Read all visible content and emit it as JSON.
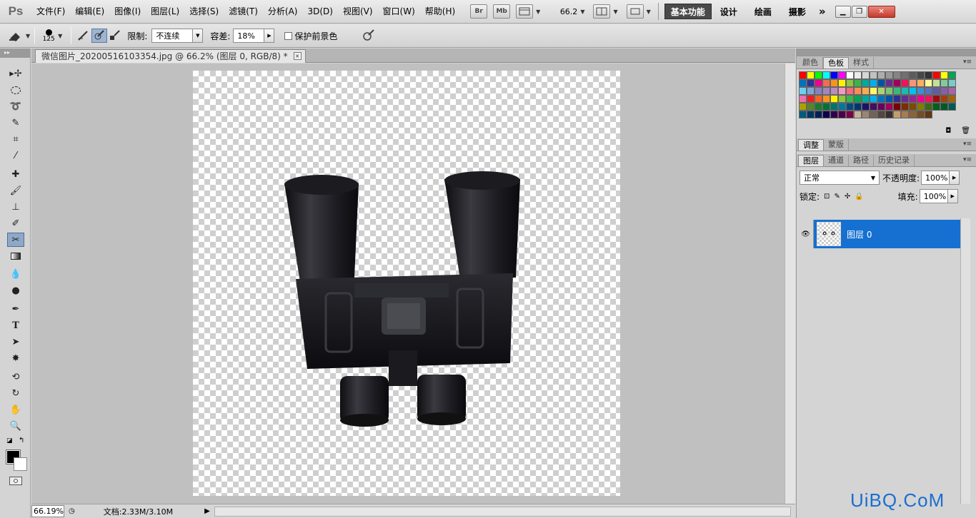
{
  "menubar": {
    "logo": "Ps",
    "items": [
      "文件(F)",
      "编辑(E)",
      "图像(I)",
      "图层(L)",
      "选择(S)",
      "滤镜(T)",
      "分析(A)",
      "3D(D)",
      "视图(V)",
      "窗口(W)",
      "帮助(H)"
    ],
    "bridge_label": "Br",
    "minibridge_label": "Mb",
    "zoom": "66.2",
    "workspaces": [
      "基本功能",
      "设计",
      "绘画",
      "摄影"
    ],
    "more": "»"
  },
  "options": {
    "brush_size": "125",
    "limit_label": "限制:",
    "limit_value": "不连续",
    "tolerance_label": "容差:",
    "tolerance_value": "18%",
    "protect_label": "保护前景色"
  },
  "document": {
    "tab_title": "微信图片_20200516103354.jpg @ 66.2% (图层 0, RGB/8) *",
    "close": "×"
  },
  "statusbar": {
    "zoom": "66.19%",
    "doc_info": "文档:2.33M/3.10M"
  },
  "swatches_panel": {
    "tabs": [
      "颜色",
      "色板",
      "样式"
    ],
    "active_tab": "色板",
    "colors": [
      "#ff0000",
      "#ffff00",
      "#00ff00",
      "#00ffff",
      "#0000ff",
      "#ff00ff",
      "#ffffff",
      "#ebebeb",
      "#d6d6d6",
      "#c2c2c2",
      "#adadad",
      "#999999",
      "#858585",
      "#707070",
      "#5c5c5c",
      "#474747",
      "#333333",
      "#ff0000",
      "#ffff00",
      "#00a651",
      "#0071bc",
      "#2e3192",
      "#ec008c",
      "#f26c4f",
      "#f7941d",
      "#fff200",
      "#8dc63f",
      "#39b54a",
      "#00a99d",
      "#00aeef",
      "#0054a6",
      "#662d91",
      "#9e005d",
      "#ed145b",
      "#f69679",
      "#fbaf5d",
      "#fff799",
      "#c4df9b",
      "#82ca9c",
      "#7accc8",
      "#6dcff6",
      "#7da7d9",
      "#8781bd",
      "#a186be",
      "#bd8cbf",
      "#f49ac1",
      "#f26d7d",
      "#f68e55",
      "#fbad4e",
      "#fff568",
      "#acd372",
      "#7cc576",
      "#3bb878",
      "#1abbb4",
      "#00bff3",
      "#448ccb",
      "#5574b9",
      "#605ca8",
      "#855fa8",
      "#a863a8",
      "#f06eaa",
      "#ed1c24",
      "#f26522",
      "#f7941d",
      "#fff200",
      "#8dc63f",
      "#39b54a",
      "#00a651",
      "#00a99d",
      "#00aeef",
      "#0072bc",
      "#0054a6",
      "#2e3192",
      "#662d91",
      "#92278f",
      "#ec008c",
      "#ed145b",
      "#9e0b0f",
      "#a0410d",
      "#a36209",
      "#aba000",
      "#598527",
      "#1a7b30",
      "#007236",
      "#00746b",
      "#0076a3",
      "#004a80",
      "#003471",
      "#1b1464",
      "#440e62",
      "#630460",
      "#9e005d",
      "#790000",
      "#7b2e00",
      "#7d4900",
      "#827b00",
      "#406618",
      "#005e20",
      "#005826",
      "#005952",
      "#005b7f",
      "#003663",
      "#002157",
      "#0d004c",
      "#32004b",
      "#4b0049",
      "#7b0046",
      "#c7b299",
      "#998675",
      "#736357",
      "#534741",
      "#37302a",
      "#c69c6d",
      "#a67c52",
      "#8c6239",
      "#754c24",
      "#603913"
    ]
  },
  "adjust_panel": {
    "tabs": [
      "调整",
      "蒙版"
    ],
    "active_tab": "调整"
  },
  "layers_panel": {
    "tabs": [
      "图层",
      "通道",
      "路径",
      "历史记录"
    ],
    "active_tab": "图层",
    "blend_mode": "正常",
    "opacity_label": "不透明度:",
    "opacity_value": "100%",
    "lock_label": "锁定:",
    "fill_label": "填充:",
    "fill_value": "100%",
    "layers": [
      {
        "name": "图层 0",
        "visible": true,
        "selected": true
      }
    ]
  },
  "watermark": "UiBQ.CoM"
}
